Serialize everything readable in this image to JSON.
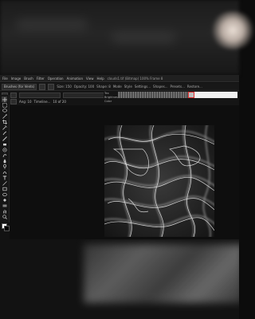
{
  "app": {
    "menus": [
      "File",
      "Image",
      "Brush",
      "Filter",
      "Operation",
      "Animation",
      "View",
      "Help"
    ],
    "document_title": "clouds1.tif (Bitmap) 100% Frame 8"
  },
  "toolbar": {
    "brush_field": "Brushes (for Vents)",
    "brush_size_label": "Size: 150",
    "opacity_label": "Opacity: 100",
    "shape_label": "Shape: 8",
    "mode_label": "Mode",
    "style_label": "Style",
    "buttons": [
      "Settings...",
      "Shapes...",
      "Presets...",
      "Restore..."
    ]
  },
  "options": {
    "angle_label": "Ang: 10",
    "timeline_label": "Timeline...",
    "frames_label": "10 of 20"
  },
  "texture": {
    "labels": [
      "Tex",
      "Brightness",
      "Color"
    ]
  },
  "colors": {
    "foreground": "#ffffff",
    "background": "#000000",
    "accent": "#e03030"
  },
  "tools": [
    "move-icon",
    "select-icon",
    "lasso-icon",
    "wand-icon",
    "crop-icon",
    "eyedropper-icon",
    "brush-icon",
    "pencil-icon",
    "eraser-icon",
    "clone-icon",
    "smudge-icon",
    "blur-icon",
    "dodge-icon",
    "burn-icon",
    "text-icon",
    "line-icon",
    "rect-icon",
    "ellipse-icon",
    "fill-icon",
    "gradient-icon",
    "hand-icon",
    "zoom-icon"
  ]
}
